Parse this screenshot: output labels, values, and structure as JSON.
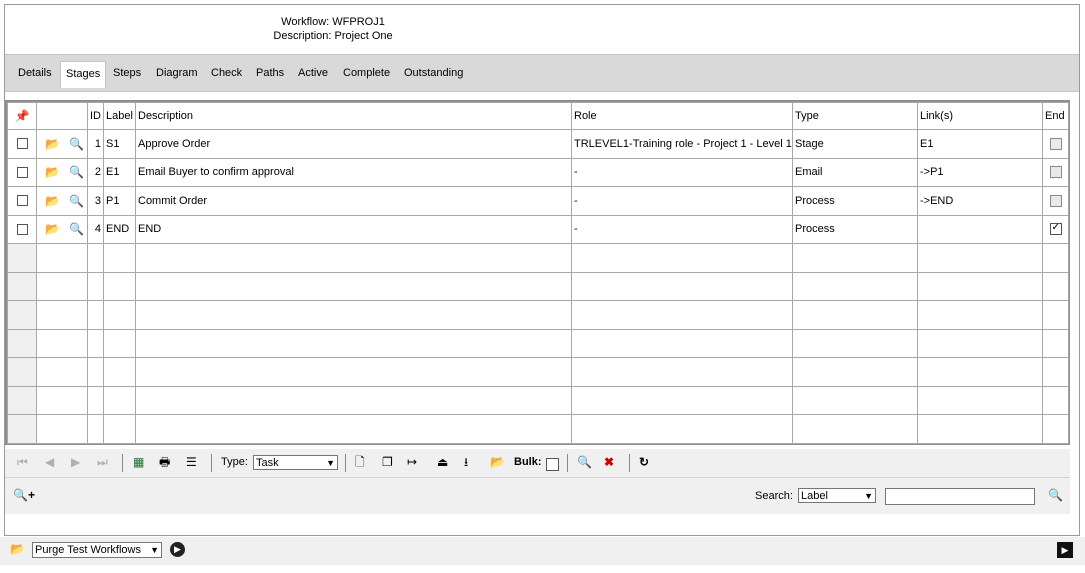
{
  "header": {
    "workflow_line": "Workflow: WFPROJ1",
    "description_line": "Description: Project One"
  },
  "tabs": [
    {
      "label": "Details"
    },
    {
      "label": "Stages"
    },
    {
      "label": "Steps"
    },
    {
      "label": "Diagram"
    },
    {
      "label": "Check"
    },
    {
      "label": "Paths"
    },
    {
      "label": "Active"
    },
    {
      "label": "Complete"
    },
    {
      "label": "Outstanding"
    }
  ],
  "active_tab": "Stages",
  "grid": {
    "columns": {
      "id": "ID",
      "label": "Label",
      "description": "Description",
      "role": "Role",
      "type": "Type",
      "links": "Link(s)",
      "end": "End"
    },
    "rows": [
      {
        "id": "1",
        "label": "S1",
        "description": "Approve Order",
        "role": "TRLEVEL1-Training role - Project 1 - Level 1",
        "type": "Stage",
        "links": "E1",
        "end": false
      },
      {
        "id": "2",
        "label": "E1",
        "description": "Email Buyer to confirm approval",
        "role": "-",
        "type": "Email",
        "links": "->P1",
        "end": false
      },
      {
        "id": "3",
        "label": "P1",
        "description": "Commit Order",
        "role": "-",
        "type": "Process",
        "links": "->END",
        "end": false
      },
      {
        "id": "4",
        "label": "END",
        "description": "END",
        "role": "-",
        "type": "Process",
        "links": "",
        "end": true
      }
    ]
  },
  "toolbar": {
    "type_label": "Type:",
    "type_value": "Task",
    "bulk_label": "Bulk:"
  },
  "search": {
    "label": "Search:",
    "field_value": "Label",
    "input_value": ""
  },
  "bottom": {
    "purge_value": "Purge Test Workflows"
  },
  "colors": {
    "delete_red": "#cc0000",
    "tab_bar": "#d9d9d9"
  },
  "icons": [
    "pin-icon",
    "folder-open-icon",
    "preview-icon",
    "first-page-icon",
    "prev-page-icon",
    "next-page-icon",
    "last-page-icon",
    "excel-icon",
    "print-icon",
    "list-icon",
    "new-doc-icon",
    "copy-icon",
    "move-icon",
    "move-up-icon",
    "move-down-icon",
    "open-icon",
    "delete-icon",
    "refresh-icon",
    "zoom-add-icon",
    "search-icon",
    "go-icon",
    "expand-icon"
  ]
}
